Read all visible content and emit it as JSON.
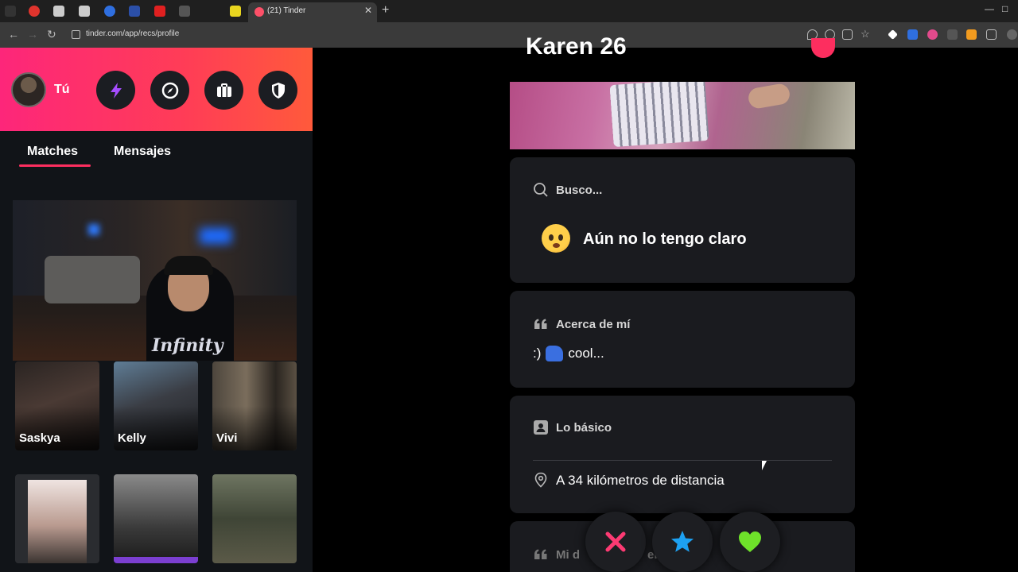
{
  "browser": {
    "tab_title": "(21) Tinder",
    "tab_close": "✕",
    "new_tab": "+",
    "url": "tinder.com/app/recs/profile",
    "window_minimize": "—",
    "window_maximize": "□"
  },
  "sidebar": {
    "user_label": "Tú",
    "header_buttons": [
      "boost-button",
      "explore-button",
      "work-button",
      "safety-button"
    ],
    "tabs": {
      "matches": "Matches",
      "messages": "Mensajes"
    },
    "match_cards": [
      {
        "name": "Saskya"
      },
      {
        "name": "Kelly"
      },
      {
        "name": "Vivi"
      },
      {
        "name": ""
      },
      {
        "name": ""
      },
      {
        "name": ""
      }
    ],
    "webcam_shirt_text": "Infinity"
  },
  "profile": {
    "name_age": "Karen 26",
    "looking_for": {
      "label": "Busco...",
      "value": "Aún no lo tengo claro"
    },
    "about": {
      "label": "Acerca de mí",
      "text_prefix": ":)",
      "text_suffix": "cool..."
    },
    "basics": {
      "label": "Lo básico",
      "distance": "A 34 kilómetros de distancia"
    },
    "next_section_partial": "Mi d       o de      ema"
  },
  "colors": {
    "brand_gradient_start": "#fd267a",
    "brand_gradient_end": "#ff5a3b",
    "nope": "#fd3a73",
    "superlike": "#1da1f2",
    "like": "#6ee22a"
  }
}
